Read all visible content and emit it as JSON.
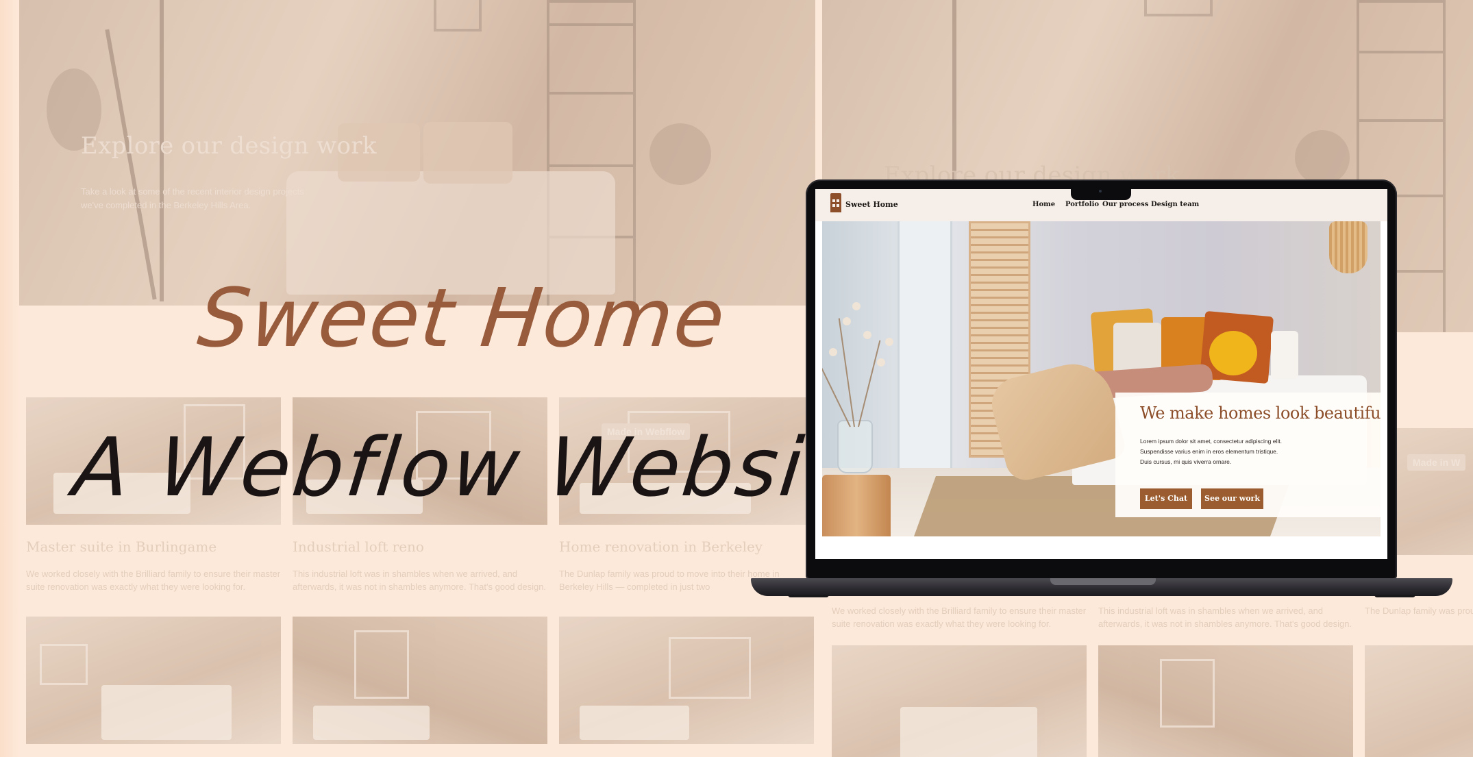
{
  "colors": {
    "background": "#fde9da",
    "brand": "#8c4e29",
    "button": "#9b5d2f",
    "headline_accent": "#985c3c",
    "headline_dark": "#1a1414"
  },
  "background_page": {
    "hero_title": "Explore our design work",
    "hero_subtitle": "Take a look at some of the recent interior design projects we've completed in the Berkeley Hills Area.",
    "hero_title_partial": "Explore our design work",
    "badge": "Made in Webflow",
    "badge_partial": "Made in W",
    "projects": [
      {
        "title": "Master suite in Burlingame",
        "description": "We worked closely with the Brilliard family to ensure their master suite renovation was exactly what they were looking for."
      },
      {
        "title": "Industrial loft reno",
        "description": "This industrial loft was in shambles when we arrived, and afterwards, it was not in shambles anymore. That's good design."
      },
      {
        "title": "Home renovation in Berkeley",
        "description": "The Dunlap family was proud to move into their home in Berkeley Hills — completed in just two"
      }
    ],
    "right_projects": [
      {
        "description": "We worked closely with the Brilliard family to ensure their master suite renovation was exactly what they were looking for."
      },
      {
        "description": "This industrial loft was in shambles when we arrived, and afterwards, it was not in shambles anymore. That's good design."
      },
      {
        "description": "The Dunlap family was proud to move into their home in Berkeley Hills — co"
      }
    ]
  },
  "headline": {
    "line1": "Sweet Home",
    "line2": "A Webflow Website"
  },
  "site": {
    "logo_text": "Sweet Home",
    "logo_icon": "house-icon",
    "nav": [
      "Home",
      "Portfolio",
      "Our process",
      "Design team"
    ],
    "hero": {
      "title": "We make homes look beautiful.",
      "body": "Lorem ipsum dolor sit amet, consectetur adipiscing elit. Suspendisse varius enim in eros elementum tristique. Duis cursus, mi quis viverra ornare.",
      "cta_primary": "Let's Chat",
      "cta_secondary": "See our work"
    }
  }
}
